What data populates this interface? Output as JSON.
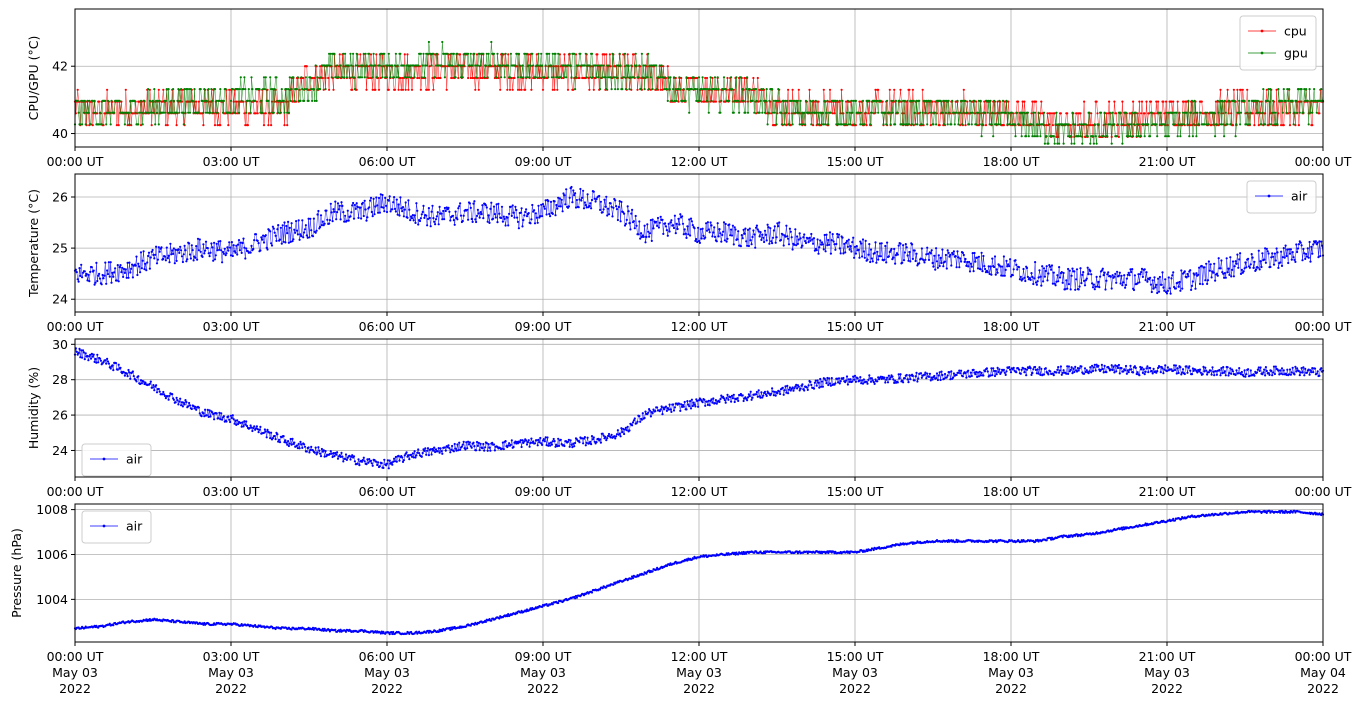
{
  "chart_data": [
    {
      "type": "line",
      "ylabel": "CPU/GPU (°C)",
      "xlim": [
        "2022-05-03 00:00",
        "2022-05-04 00:00"
      ],
      "ylim": [
        39.6,
        43.7
      ],
      "yticks": [
        40,
        42
      ],
      "grid": true,
      "legend_position": "upper-right",
      "series": [
        {
          "name": "cpu",
          "color": "#ff0000",
          "x": [
            "00:00",
            "01:00",
            "02:00",
            "03:00",
            "04:00",
            "04:30",
            "05:00",
            "06:00",
            "07:00",
            "08:00",
            "09:00",
            "10:00",
            "11:00",
            "11:30",
            "12:00",
            "13:00",
            "13:30",
            "14:00",
            "15:00",
            "16:00",
            "17:00",
            "18:00",
            "19:00",
            "20:00",
            "21:00",
            "22:00",
            "23:00",
            "24:00"
          ],
          "values": [
            40.7,
            40.7,
            40.8,
            40.8,
            40.7,
            41.7,
            41.8,
            41.8,
            41.9,
            41.9,
            41.8,
            41.8,
            41.8,
            41.3,
            41.3,
            41.3,
            40.8,
            40.7,
            40.7,
            40.7,
            40.7,
            40.6,
            40.3,
            40.4,
            40.6,
            40.7,
            40.7,
            40.8
          ]
        },
        {
          "name": "gpu",
          "color": "#008000",
          "x": [
            "00:00",
            "01:00",
            "02:00",
            "03:00",
            "04:00",
            "04:30",
            "05:00",
            "06:00",
            "07:00",
            "08:00",
            "09:00",
            "10:00",
            "11:00",
            "11:30",
            "12:00",
            "13:00",
            "13:30",
            "14:00",
            "15:00",
            "16:00",
            "17:00",
            "18:00",
            "19:00",
            "20:00",
            "21:00",
            "22:00",
            "23:00",
            "24:00"
          ],
          "values": [
            40.6,
            40.6,
            40.9,
            41.0,
            41.1,
            41.4,
            41.9,
            42.0,
            42.1,
            42.1,
            42.0,
            41.9,
            41.8,
            41.3,
            41.2,
            41.1,
            40.7,
            40.6,
            40.6,
            40.6,
            40.6,
            40.3,
            40.0,
            40.1,
            40.3,
            40.5,
            40.7,
            40.9
          ]
        }
      ]
    },
    {
      "type": "line",
      "ylabel": "Temperature (°C)",
      "xlim": [
        "2022-05-03 00:00",
        "2022-05-04 00:00"
      ],
      "ylim": [
        23.75,
        26.45
      ],
      "yticks": [
        24,
        25,
        26
      ],
      "grid": true,
      "legend_position": "upper-right",
      "series": [
        {
          "name": "air",
          "color": "#0000ff",
          "x": [
            "00:00",
            "00:30",
            "01:00",
            "01:30",
            "02:00",
            "02:30",
            "03:00",
            "03:30",
            "04:00",
            "04:30",
            "05:00",
            "05:30",
            "06:00",
            "06:30",
            "07:00",
            "07:30",
            "08:00",
            "08:30",
            "09:00",
            "09:30",
            "10:00",
            "10:30",
            "11:00",
            "11:30",
            "12:00",
            "12:30",
            "13:00",
            "13:30",
            "14:00",
            "14:30",
            "15:00",
            "15:30",
            "16:00",
            "16:30",
            "17:00",
            "17:30",
            "18:00",
            "18:30",
            "19:00",
            "19:30",
            "20:00",
            "20:30",
            "21:00",
            "21:30",
            "22:00",
            "22:30",
            "23:00",
            "23:30",
            "24:00"
          ],
          "values": [
            24.5,
            24.5,
            24.6,
            24.8,
            24.9,
            25.0,
            24.9,
            25.1,
            25.3,
            25.4,
            25.7,
            25.7,
            25.9,
            25.7,
            25.6,
            25.7,
            25.7,
            25.6,
            25.7,
            26.0,
            25.9,
            25.7,
            25.3,
            25.5,
            25.3,
            25.3,
            25.2,
            25.3,
            25.1,
            25.1,
            25.0,
            24.9,
            24.9,
            24.8,
            24.8,
            24.7,
            24.6,
            24.5,
            24.4,
            24.4,
            24.4,
            24.4,
            24.3,
            24.4,
            24.6,
            24.7,
            24.8,
            24.9,
            25.0
          ]
        }
      ]
    },
    {
      "type": "line",
      "ylabel": "Humidity (%)",
      "xlim": [
        "2022-05-03 00:00",
        "2022-05-04 00:00"
      ],
      "ylim": [
        22.5,
        30.3
      ],
      "yticks": [
        24,
        26,
        28,
        30
      ],
      "grid": true,
      "legend_position": "lower-left",
      "series": [
        {
          "name": "air",
          "color": "#0000ff",
          "x": [
            "00:00",
            "00:30",
            "01:00",
            "01:30",
            "02:00",
            "02:30",
            "03:00",
            "03:30",
            "04:00",
            "04:30",
            "05:00",
            "05:30",
            "06:00",
            "06:30",
            "07:00",
            "07:30",
            "08:00",
            "08:30",
            "09:00",
            "09:30",
            "10:00",
            "10:30",
            "11:00",
            "11:30",
            "12:00",
            "12:30",
            "13:00",
            "13:30",
            "14:00",
            "14:30",
            "15:00",
            "15:30",
            "16:00",
            "16:30",
            "17:00",
            "17:30",
            "18:00",
            "18:30",
            "19:00",
            "19:30",
            "20:00",
            "20:30",
            "21:00",
            "21:30",
            "22:00",
            "22:30",
            "23:00",
            "23:30",
            "24:00"
          ],
          "values": [
            29.6,
            29.1,
            28.4,
            27.6,
            26.8,
            26.1,
            25.8,
            25.2,
            24.6,
            24.1,
            23.7,
            23.4,
            23.2,
            23.8,
            24.0,
            24.3,
            24.2,
            24.4,
            24.5,
            24.4,
            24.6,
            25.0,
            26.1,
            26.4,
            26.7,
            26.9,
            27.1,
            27.3,
            27.6,
            27.9,
            28.0,
            28.0,
            28.1,
            28.2,
            28.3,
            28.4,
            28.5,
            28.5,
            28.5,
            28.6,
            28.6,
            28.5,
            28.6,
            28.5,
            28.5,
            28.4,
            28.5,
            28.5,
            28.4
          ]
        }
      ]
    },
    {
      "type": "line",
      "ylabel": "Pressure (hPa)",
      "xlim": [
        "2022-05-03 00:00",
        "2022-05-04 00:00"
      ],
      "ylim": [
        1002.1,
        1008.25
      ],
      "yticks": [
        1004,
        1006,
        1008
      ],
      "grid": true,
      "legend_position": "upper-left",
      "series": [
        {
          "name": "air",
          "color": "#0000ff",
          "x": [
            "00:00",
            "00:30",
            "01:00",
            "01:30",
            "02:00",
            "02:30",
            "03:00",
            "03:30",
            "04:00",
            "04:30",
            "05:00",
            "05:30",
            "06:00",
            "06:30",
            "07:00",
            "07:30",
            "08:00",
            "08:30",
            "09:00",
            "09:30",
            "10:00",
            "10:30",
            "11:00",
            "11:30",
            "12:00",
            "12:30",
            "13:00",
            "13:30",
            "14:00",
            "14:30",
            "15:00",
            "15:30",
            "16:00",
            "16:30",
            "17:00",
            "17:30",
            "18:00",
            "18:30",
            "19:00",
            "19:30",
            "20:00",
            "20:30",
            "21:00",
            "21:30",
            "22:00",
            "22:30",
            "23:00",
            "23:30",
            "24:00"
          ],
          "values": [
            1002.7,
            1002.8,
            1003.0,
            1003.1,
            1003.0,
            1002.9,
            1002.9,
            1002.8,
            1002.7,
            1002.7,
            1002.6,
            1002.6,
            1002.5,
            1002.5,
            1002.6,
            1002.8,
            1003.1,
            1003.4,
            1003.7,
            1004.0,
            1004.4,
            1004.8,
            1005.2,
            1005.6,
            1005.9,
            1006.0,
            1006.1,
            1006.1,
            1006.1,
            1006.1,
            1006.1,
            1006.3,
            1006.5,
            1006.6,
            1006.6,
            1006.6,
            1006.6,
            1006.6,
            1006.8,
            1006.9,
            1007.1,
            1007.3,
            1007.5,
            1007.7,
            1007.8,
            1007.9,
            1007.9,
            1007.9,
            1007.8
          ]
        }
      ]
    }
  ],
  "x_tick_labels": [
    "00:00 UT",
    "03:00 UT",
    "06:00 UT",
    "09:00 UT",
    "12:00 UT",
    "15:00 UT",
    "18:00 UT",
    "21:00 UT",
    "00:00 UT"
  ],
  "x_tick_dates": [
    "May 03",
    "May 03",
    "May 03",
    "May 03",
    "May 03",
    "May 03",
    "May 03",
    "May 03",
    "May 04"
  ],
  "x_tick_years": [
    "2022",
    "2022",
    "2022",
    "2022",
    "2022",
    "2022",
    "2022",
    "2022",
    "2022"
  ]
}
